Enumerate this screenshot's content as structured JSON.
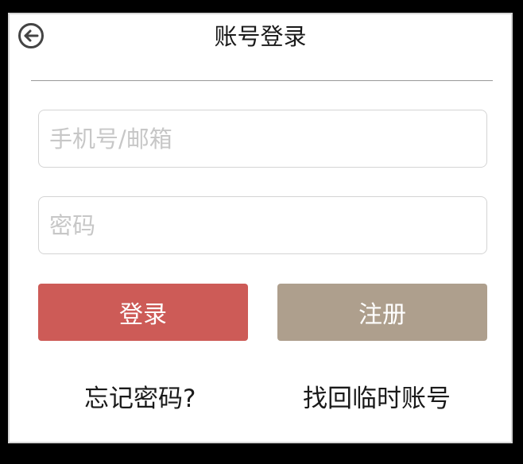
{
  "header": {
    "title": "账号登录",
    "back_icon": "back-arrow-icon"
  },
  "form": {
    "account_placeholder": "手机号/邮箱",
    "account_value": "",
    "password_placeholder": "密码",
    "password_value": ""
  },
  "buttons": {
    "login_label": "登录",
    "register_label": "注册"
  },
  "links": {
    "forgot_password": "忘记密码?",
    "recover_temp_account": "找回临时账号"
  },
  "colors": {
    "login_button": "#cd5b57",
    "register_button": "#ae9f8d",
    "placeholder": "#c7c7c7",
    "divider": "#999999"
  }
}
